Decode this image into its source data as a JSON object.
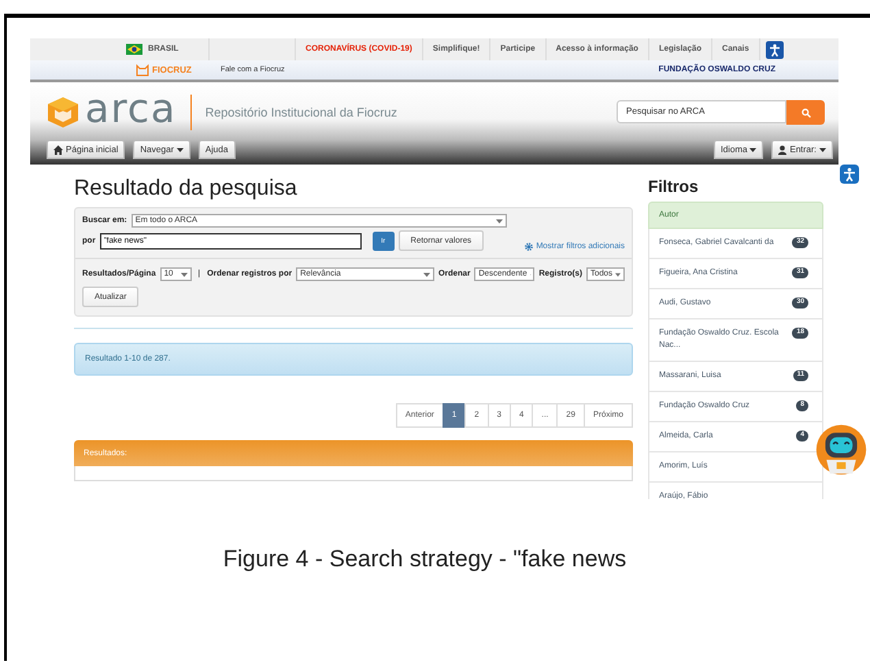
{
  "gov_bar": {
    "country": "BRASIL",
    "links": [
      {
        "label": "CORONAVÍRUS (COVID-19)",
        "kind": "alert"
      },
      {
        "label": "Simplifique!",
        "kind": "normal"
      },
      {
        "label": "Participe",
        "kind": "normal"
      },
      {
        "label": "Acesso à informação",
        "kind": "normal"
      },
      {
        "label": "Legislação",
        "kind": "normal"
      },
      {
        "label": "Canais",
        "kind": "normal"
      }
    ]
  },
  "fiocruz_bar": {
    "logo": "FIOCRUZ",
    "link": "Fale com a Fiocruz",
    "org": "FUNDAÇÃO OSWALDO CRUZ"
  },
  "header": {
    "logo": "arca",
    "subtitle": "Repositório Institucional da Fiocruz",
    "search": {
      "placeholder": "Pesquisar no ARCA"
    }
  },
  "nav": {
    "left": [
      {
        "label": "Página inicial",
        "dropdown": false
      },
      {
        "label": "Navegar",
        "dropdown": true
      },
      {
        "label": "Ajuda",
        "dropdown": false
      }
    ],
    "right": [
      {
        "label": "Idioma",
        "dropdown": true
      },
      {
        "label": "Entrar:",
        "dropdown": true
      }
    ]
  },
  "search": {
    "title": "Resultado da pesquisa",
    "scope_label": "Buscar em:",
    "scope": "Em todo o ARCA",
    "query_label": "por",
    "query": "\"fake news\"",
    "go": "Ir",
    "reset": "Retornar valores",
    "more_filters": "Mostrar filtros adicionais",
    "per_page_label": "Resultados/Página",
    "per_page": "10",
    "separator": "|",
    "sort_label": "Ordenar registros por",
    "sort": "Relevância",
    "order_label": "Ordenar",
    "order": "Descendente",
    "records_label": "Registro(s)",
    "records": "Todos",
    "update": "Atualizar"
  },
  "result_info": "Resultado 1-10 de 287.",
  "pagination": [
    {
      "label": "Anterior",
      "selected": false
    },
    {
      "label": "1",
      "selected": true
    },
    {
      "label": "2",
      "selected": false
    },
    {
      "label": "3",
      "selected": false
    },
    {
      "label": "4",
      "selected": false
    },
    {
      "label": "...",
      "selected": false
    },
    {
      "label": "29",
      "selected": false
    },
    {
      "label": "Próximo",
      "selected": false
    }
  ],
  "results_header": "Resultados:",
  "filters": {
    "title": "Filtros",
    "group": "Autor",
    "items": [
      {
        "name": "Fonseca, Gabriel Cavalcanti da",
        "count": "32"
      },
      {
        "name": "Figueira, Ana Cristina",
        "count": "31"
      },
      {
        "name": "Audi, Gustavo",
        "count": "30"
      },
      {
        "name": "Fundação Oswaldo Cruz. Escola Nac...",
        "count": "18"
      },
      {
        "name": "Massarani, Luisa",
        "count": "11"
      },
      {
        "name": "Fundação Oswaldo Cruz",
        "count": "8"
      },
      {
        "name": "Almeida, Carla",
        "count": "4"
      },
      {
        "name": "Amorim, Luís"
      },
      {
        "name": "Araújo, Fábio"
      }
    ]
  },
  "caption": "Figure 4 - Search strategy - \"fake news"
}
